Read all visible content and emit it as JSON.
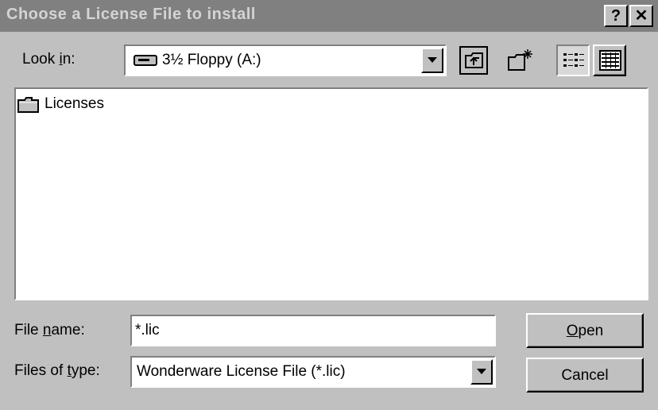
{
  "window": {
    "title": "Choose a License File to install",
    "help_label": "?",
    "close_label": "✕"
  },
  "look_in": {
    "label_pre": "Look ",
    "label_key": "i",
    "label_post": "n:",
    "value": "3½ Floppy (A:)",
    "icon": "floppy-drive-icon"
  },
  "toolbar": {
    "up_icon": "up-one-level-icon",
    "new_folder_icon": "create-new-folder-icon",
    "list_icon": "list-view-icon",
    "details_icon": "details-view-icon"
  },
  "file_list": {
    "items": [
      {
        "name": "Licenses",
        "icon": "folder-icon"
      }
    ]
  },
  "file_name": {
    "label_pre": "File ",
    "label_key": "n",
    "label_post": "ame:",
    "value": "*.lic"
  },
  "file_type": {
    "label_pre": "Files of ",
    "label_key": "t",
    "label_post": "ype:",
    "value": "Wonderware License File (*.lic)"
  },
  "buttons": {
    "open_key": "O",
    "open_rest": "pen",
    "cancel": "Cancel"
  }
}
